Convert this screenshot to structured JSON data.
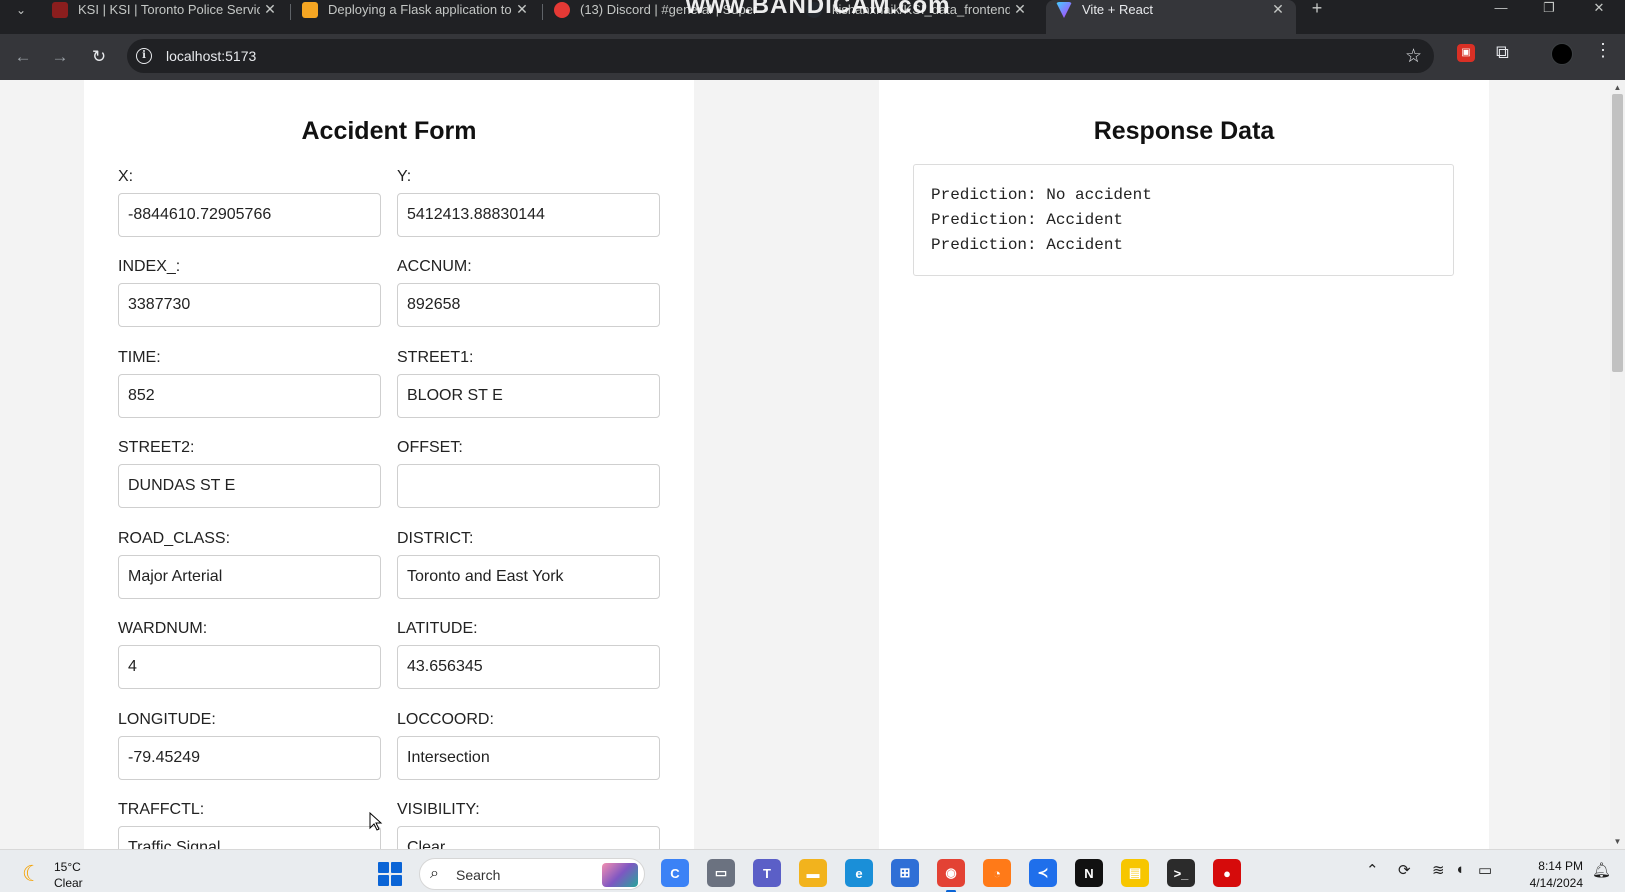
{
  "browser": {
    "tabs": [
      {
        "title": "KSI | KSI | Toronto Police Service",
        "favicon_color": "#8b1e1e",
        "active": false
      },
      {
        "title": "Deploying a Flask application to",
        "favicon_color": "#f5a623",
        "active": false
      },
      {
        "title": "(13) Discord | #general | Super",
        "favicon_color": "#e53935",
        "active": false
      },
      {
        "title": "kishanxnaik/KSI_data_frontend",
        "favicon_color": "#24292f",
        "active": false
      },
      {
        "title": "Vite + React",
        "favicon_color": "#7c4dff",
        "active": true
      }
    ],
    "new_tab_symbol": "+",
    "recorder_watermark": "www.BANDICAM.com",
    "url": "localhost:5173",
    "info_symbol": "i"
  },
  "form": {
    "title": "Accident Form",
    "fields": [
      {
        "label": "X:",
        "value": "-8844610.72905766"
      },
      {
        "label": "Y:",
        "value": "5412413.88830144"
      },
      {
        "label": "INDEX_:",
        "value": "3387730"
      },
      {
        "label": "ACCNUM:",
        "value": "892658"
      },
      {
        "label": "TIME:",
        "value": "852"
      },
      {
        "label": "STREET1:",
        "value": "BLOOR ST E"
      },
      {
        "label": "STREET2:",
        "value": "DUNDAS ST E"
      },
      {
        "label": "OFFSET:",
        "value": ""
      },
      {
        "label": "ROAD_CLASS:",
        "value": "Major Arterial"
      },
      {
        "label": "DISTRICT:",
        "value": "Toronto and East York"
      },
      {
        "label": "WARDNUM:",
        "value": "4"
      },
      {
        "label": "LATITUDE:",
        "value": "43.656345"
      },
      {
        "label": "LONGITUDE:",
        "value": "-79.45249"
      },
      {
        "label": "LOCCOORD:",
        "value": "Intersection"
      },
      {
        "label": "TRAFFCTL:",
        "value": "Traffic Signal"
      },
      {
        "label": "VISIBILITY:",
        "value": "Clear"
      }
    ]
  },
  "response": {
    "title": "Response Data",
    "lines": [
      "Prediction: No accident",
      "Prediction: Accident",
      "Prediction: Accident"
    ]
  },
  "taskbar": {
    "weather_temp": "15°C",
    "weather_desc": "Clear",
    "search_label": "Search",
    "time": "8:14 PM",
    "date": "4/14/2024",
    "apps": [
      {
        "name": "copilot-app",
        "color": "#3b82f6",
        "glyph": "C"
      },
      {
        "name": "file-explorer-alt-app",
        "color": "#6b7280",
        "glyph": "▭"
      },
      {
        "name": "teams-app",
        "color": "#5b5fc7",
        "glyph": "T"
      },
      {
        "name": "file-explorer-app",
        "color": "#f2b31d",
        "glyph": "▬"
      },
      {
        "name": "edge-app",
        "color": "#1a8fd8",
        "glyph": "e"
      },
      {
        "name": "microsoft-store-app",
        "color": "#2f6fd6",
        "glyph": "⊞"
      },
      {
        "name": "chrome-app",
        "color": "#e34234",
        "glyph": "◉"
      },
      {
        "name": "firefox-app",
        "color": "#ff7a18",
        "glyph": "◔"
      },
      {
        "name": "vscode-app",
        "color": "#1f6feb",
        "glyph": "≺"
      },
      {
        "name": "netflix-app",
        "color": "#111111",
        "glyph": "N"
      },
      {
        "name": "sticky-notes-app",
        "color": "#f7c600",
        "glyph": "▤"
      },
      {
        "name": "terminal-app",
        "color": "#2b2b2b",
        "glyph": ">_"
      },
      {
        "name": "bandicam-app",
        "color": "#d60b0b",
        "glyph": "●"
      }
    ]
  }
}
